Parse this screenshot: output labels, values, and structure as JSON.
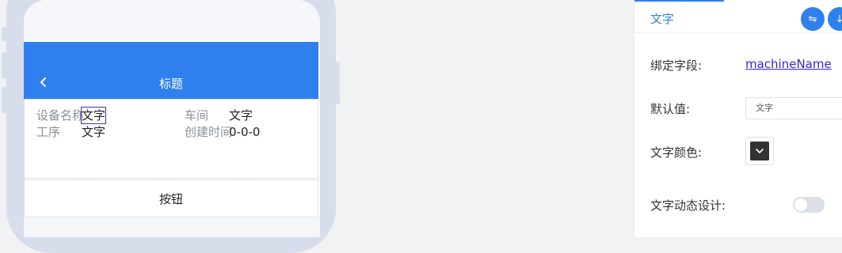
{
  "phone": {
    "nav_title": "标题",
    "fields": [
      {
        "label": "设备名称",
        "value": "文字"
      },
      {
        "label": "车间",
        "value": "文字"
      },
      {
        "label": "工序",
        "value": "文字"
      },
      {
        "label": "创建时间",
        "value": "0-0-0"
      }
    ],
    "button_label": "按钮"
  },
  "panel": {
    "tab_label": "文字",
    "btn1_icon": "⇋",
    "btn2_icon": "↓",
    "bind_field_label": "绑定字段:",
    "bind_field_value": "machineName",
    "default_label": "默认值:",
    "default_value": "文字",
    "color_label": "文字颜色:",
    "text_color": "#333333",
    "dynamic_label": "文字动态设计:",
    "dynamic_enabled": false
  },
  "colors": {
    "accent": "#2f80ed",
    "link": "#3b1fd0",
    "phone_frame": "#d7ddeb"
  }
}
